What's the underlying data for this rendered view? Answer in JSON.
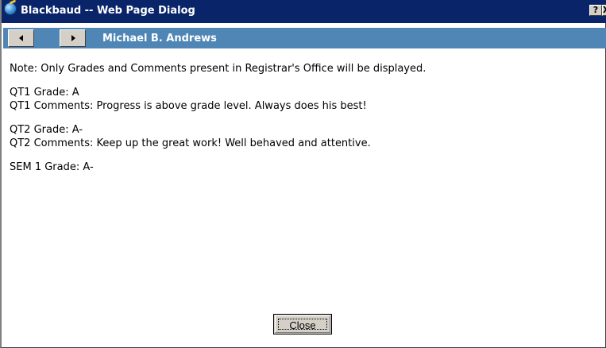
{
  "window": {
    "title": "Blackbaud -- Web Page Dialog",
    "help_label": "?",
    "close_label": "X"
  },
  "navbar": {
    "student_name": "Michael B. Andrews"
  },
  "content": {
    "note": "Note: Only Grades and Comments present in Registrar's Office will be displayed.",
    "blocks": [
      {
        "grade": "QT1 Grade: A",
        "comments": "QT1 Comments: Progress is above grade level. Always does his best!"
      },
      {
        "grade": "QT2 Grade: A-",
        "comments": "QT2 Comments: Keep up the great work! Well behaved and attentive."
      },
      {
        "grade": "SEM 1 Grade: A-"
      }
    ]
  },
  "footer": {
    "close_label": "Close"
  },
  "colors": {
    "titlebar": "#0a246a",
    "navbar": "#4f86b6",
    "button_face": "#d4d0c8"
  },
  "icons": {
    "window_icon": "ie-globe-icon",
    "prev": "arrow-left-icon",
    "next": "arrow-right-icon"
  }
}
